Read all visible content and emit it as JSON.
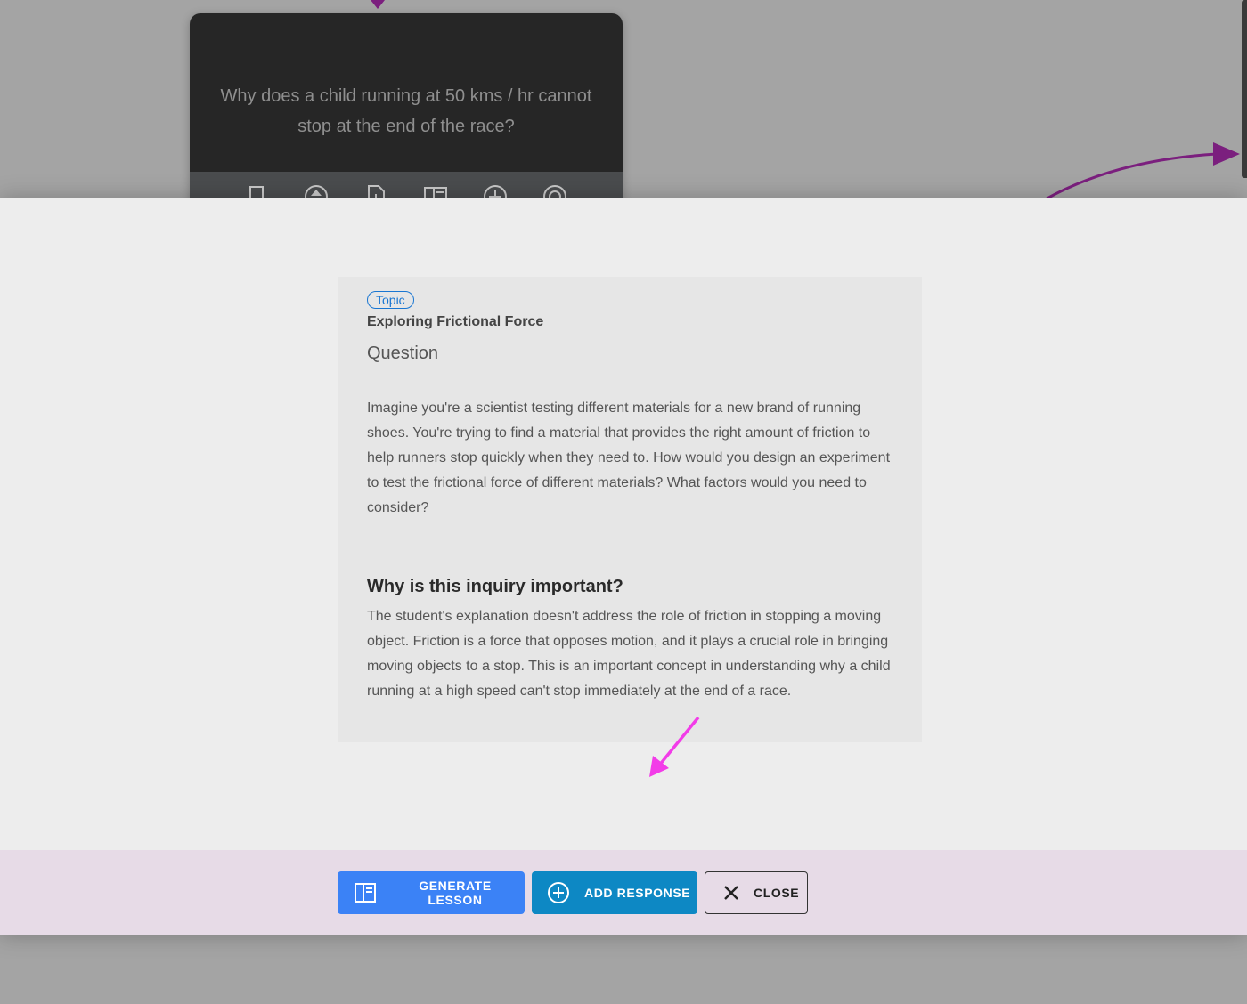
{
  "background_node": {
    "text": "Why does a child running at 50 kms / hr cannot stop at the end of the race?",
    "toolbar_icons": [
      "bookmark-icon",
      "arrow-up-circle-icon",
      "note-add-icon",
      "book-icon",
      "add-circle-icon",
      "target-icon"
    ]
  },
  "card": {
    "topic_chip": "Topic",
    "topic_title": "Exploring Frictional Force",
    "section_heading": "Question",
    "question_text": "Imagine you're a scientist testing different materials for a new brand of running shoes. You're trying to find a material that provides the right amount of friction to help runners stop quickly when they need to. How would you design an experiment to test the frictional force of different materials? What factors would you need to consider?",
    "importance_heading": "Why is this inquiry important?",
    "importance_text": "The student's explanation doesn't address the role of friction in stopping a moving object. Friction is a force that opposes motion, and it plays a crucial role in bringing moving objects to a stop. This is an important concept in understanding why a child running at a high speed can't stop immediately at the end of a race."
  },
  "actions": {
    "generate_label": "GENERATE LESSON",
    "add_response_label": "ADD RESPONSE",
    "close_label": "CLOSE"
  },
  "colors": {
    "accent_blue": "#3b82f6",
    "accent_teal": "#0d88c4",
    "chip_blue": "#1976d2",
    "connector_purple": "#7b1f7e",
    "annotation_pink": "#f23ce8",
    "action_bar_bg": "#e7dbe7"
  }
}
